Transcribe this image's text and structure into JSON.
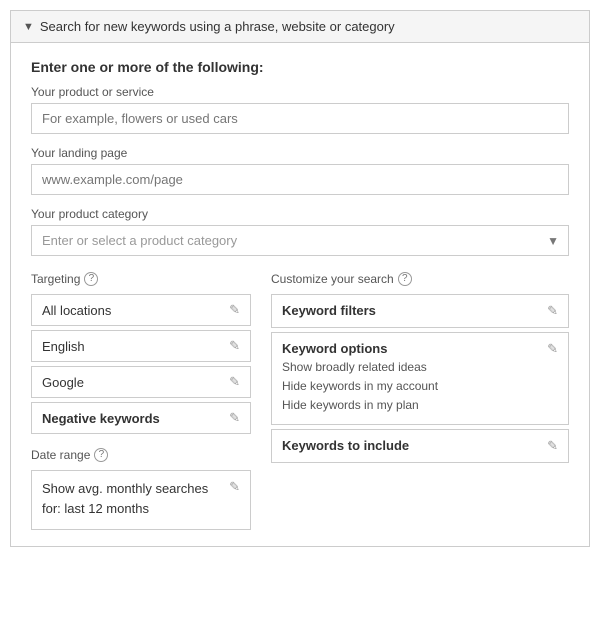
{
  "panel": {
    "header_title": "Search for new keywords using a phrase, website or category",
    "header_arrow": "▼"
  },
  "form": {
    "section_title": "Enter one or more of the following:",
    "product_label": "Your product or service",
    "product_placeholder": "For example, flowers or used cars",
    "landing_label": "Your landing page",
    "landing_placeholder": "www.example.com/page",
    "category_label": "Your product category",
    "category_placeholder": "Enter or select a product category"
  },
  "targeting": {
    "title": "Targeting",
    "help": "?",
    "options": [
      {
        "label": "All locations",
        "bold": false
      },
      {
        "label": "English",
        "bold": false
      },
      {
        "label": "Google",
        "bold": false
      },
      {
        "label": "Negative keywords",
        "bold": true
      }
    ]
  },
  "date_range": {
    "title": "Date range",
    "help": "?",
    "text_line1": "Show avg. monthly searches",
    "text_line2": "for: last 12 months"
  },
  "customize": {
    "title": "Customize your search",
    "help": "?",
    "sections": [
      {
        "label": "Keyword filters",
        "bold": true,
        "sub_items": []
      },
      {
        "label": "Keyword options",
        "bold": true,
        "sub_items": [
          "Show broadly related ideas",
          "Hide keywords in my account",
          "Hide keywords in my plan"
        ]
      },
      {
        "label": "Keywords to include",
        "bold": true,
        "sub_items": []
      }
    ]
  },
  "icons": {
    "edit": "✎",
    "dropdown_arrow": "▼",
    "help": "?"
  }
}
